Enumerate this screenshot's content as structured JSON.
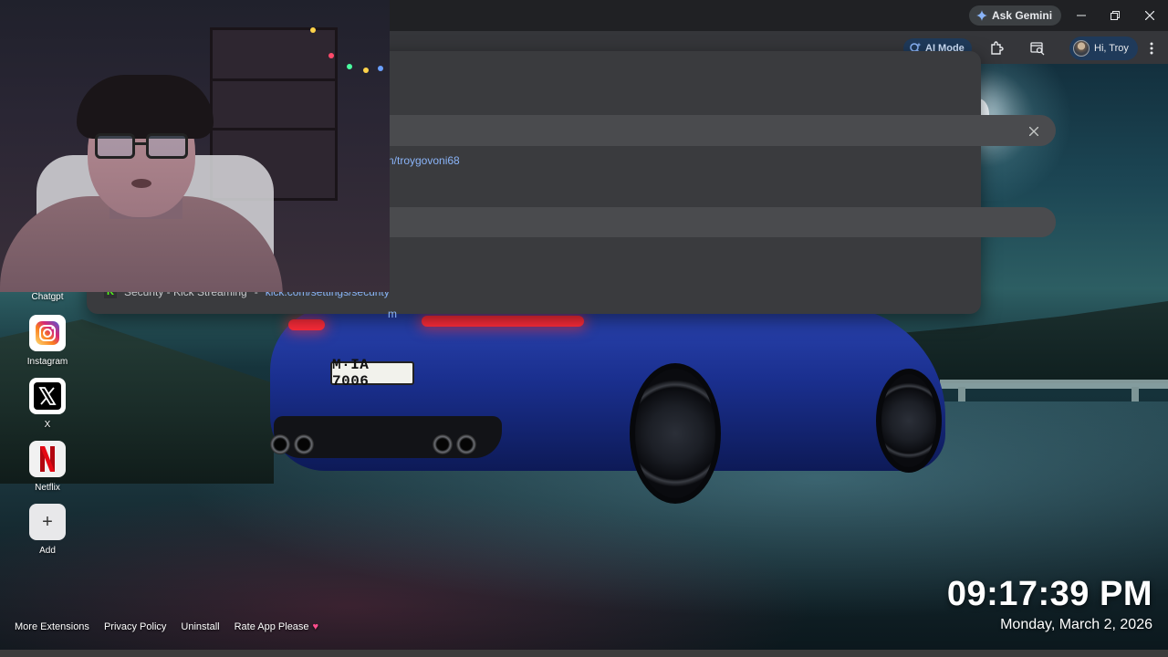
{
  "browser": {
    "ask_gemini_label": "Ask Gemini",
    "ai_mode_label": "AI Mode",
    "profile_label": "Hi, Troy",
    "icons": {
      "gemini": "gemini-spark-icon",
      "minimize": "minimize-icon",
      "restore": "restore-icon",
      "close": "close-icon",
      "ai_mode": "ai-mode-search-icon",
      "extensions": "extensions-icon",
      "search_tab": "search-tab-icon",
      "menu": "kebab-menu-icon"
    }
  },
  "omnibox": {
    "url_fragment": "n/troygovoni68",
    "url_fragment_2": "m",
    "suggestion": {
      "badge": "K",
      "title": "Security - Kick Streaming",
      "separator": "-",
      "url": "kick.com/settings/security"
    }
  },
  "shortcuts": [
    {
      "label": "Chatgpt",
      "icon": "chatgpt-icon"
    },
    {
      "label": "Instagram",
      "icon": "instagram-icon"
    },
    {
      "label": "X",
      "icon": "x-logo-icon"
    },
    {
      "label": "Netflix",
      "icon": "netflix-icon"
    },
    {
      "label": "Add",
      "icon": "plus-icon",
      "glyph": "+"
    }
  ],
  "wallpaper": {
    "license_plate": "M·IA 7006"
  },
  "footer": {
    "links": [
      "More Extensions",
      "Privacy Policy",
      "Uninstall",
      "Rate App Please"
    ],
    "heart": "♥"
  },
  "clock": {
    "time": "09:17:39 PM",
    "date": "Monday, March 2, 2026"
  },
  "colors": {
    "accent_blue": "#8ab4f8",
    "kick_green": "#53fc18",
    "heart_pink": "#ff4d8d",
    "netflix_red": "#e50914"
  }
}
